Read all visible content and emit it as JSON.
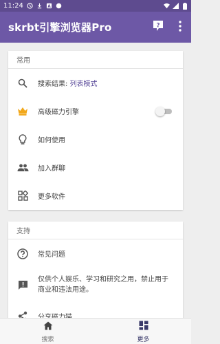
{
  "status_bar": {
    "time": "11:24",
    "left_icons": [
      "clock-icon",
      "download-icon",
      "notification-icon",
      "record-icon"
    ],
    "right_icons": [
      "wifi-icon",
      "signal-icon",
      "battery-icon"
    ]
  },
  "app_bar": {
    "title": "skrbt引擎浏览器Pro",
    "actions": [
      "help-icon",
      "more-vert-icon"
    ]
  },
  "sections": [
    {
      "header": "常用",
      "items": [
        {
          "icon": "search-icon",
          "label_prefix": "搜索结果: ",
          "label_value": "列表模式"
        },
        {
          "icon": "crown-icon",
          "label": "高级磁力引擎",
          "toggle": false
        },
        {
          "icon": "lightbulb-icon",
          "label": "如何使用"
        },
        {
          "icon": "group-icon",
          "label": "加入群聊"
        },
        {
          "icon": "apps-icon",
          "label": "更多软件"
        }
      ]
    },
    {
      "header": "支持",
      "items": [
        {
          "icon": "help-circle-icon",
          "label": "常见问题"
        },
        {
          "icon": "feedback-icon",
          "label": "仅供个人娱乐、学习和研究之用，禁止用于商业和违法用途。"
        },
        {
          "icon": "share-icon",
          "label": "分享磁力猫"
        }
      ]
    }
  ],
  "bottom_nav": [
    {
      "icon": "home-icon",
      "label": "搜索",
      "active": false
    },
    {
      "icon": "dashboard-icon",
      "label": "更多",
      "active": true
    }
  ],
  "colors": {
    "status_bar": "#5e4b8f",
    "app_bar": "#6d58a6",
    "accent_text": "#5a4a9a",
    "crown": "#f2a81b",
    "background": "#eeeeee"
  }
}
